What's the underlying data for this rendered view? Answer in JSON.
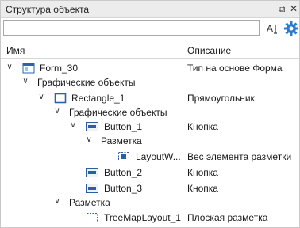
{
  "panel": {
    "title": "Структура объекта",
    "pin_icon": "⧉",
    "close_icon": "✕"
  },
  "search": {
    "value": "",
    "placeholder": ""
  },
  "columns": {
    "name": "Имя",
    "description": "Описание"
  },
  "rows": [
    {
      "name": "Form_30",
      "desc": "Тип на основе Форма"
    },
    {
      "name": "Графические объекты",
      "desc": ""
    },
    {
      "name": "Rectangle_1",
      "desc": "Прямоугольник"
    },
    {
      "name": "Графические объекты",
      "desc": ""
    },
    {
      "name": "Button_1",
      "desc": "Кнопка"
    },
    {
      "name": "Разметка",
      "desc": ""
    },
    {
      "name": "LayoutW...",
      "desc": "Вес элемента разметки"
    },
    {
      "name": "Button_2",
      "desc": "Кнопка"
    },
    {
      "name": "Button_3",
      "desc": "Кнопка"
    },
    {
      "name": "Разметка",
      "desc": ""
    },
    {
      "name": "TreeMapLayout_1",
      "desc": "Плоская разметка"
    }
  ],
  "colors": {
    "accent": "#1f6fbf",
    "button_icon": "#2b5ea8"
  }
}
